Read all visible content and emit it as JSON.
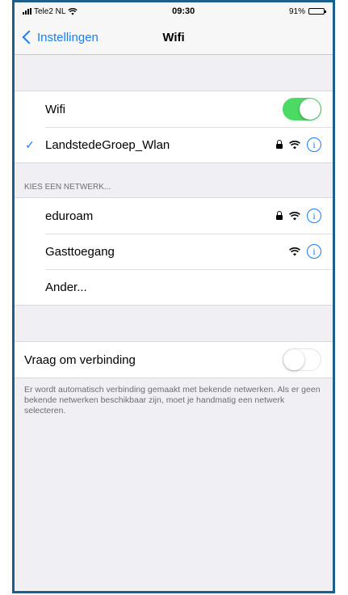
{
  "status": {
    "carrier": "Tele2 NL",
    "time": "09:30",
    "battery": "91%",
    "battery_level": 0.91
  },
  "nav": {
    "back_label": "Instellingen",
    "title": "Wifi"
  },
  "wifi_toggle": {
    "label": "Wifi",
    "state": "on"
  },
  "connected": {
    "name": "LandstedeGroep_Wlan",
    "secured": true
  },
  "networks_header": "KIES EEN NETWERK...",
  "networks": [
    {
      "name": "eduroam",
      "secured": true
    },
    {
      "name": "Gasttoegang",
      "secured": false
    }
  ],
  "other_label": "Ander...",
  "ask_to_join": {
    "label": "Vraag om verbinding",
    "state": "off",
    "description": "Er wordt automatisch verbinding gemaakt met bekende netwerken. Als er geen bekende netwerken beschikbaar zijn, moet je handmatig een netwerk selecteren."
  },
  "colors": {
    "accent": "#1a7cf5",
    "toggle_on": "#4cd964",
    "frame_border": "#1a5f8e"
  }
}
